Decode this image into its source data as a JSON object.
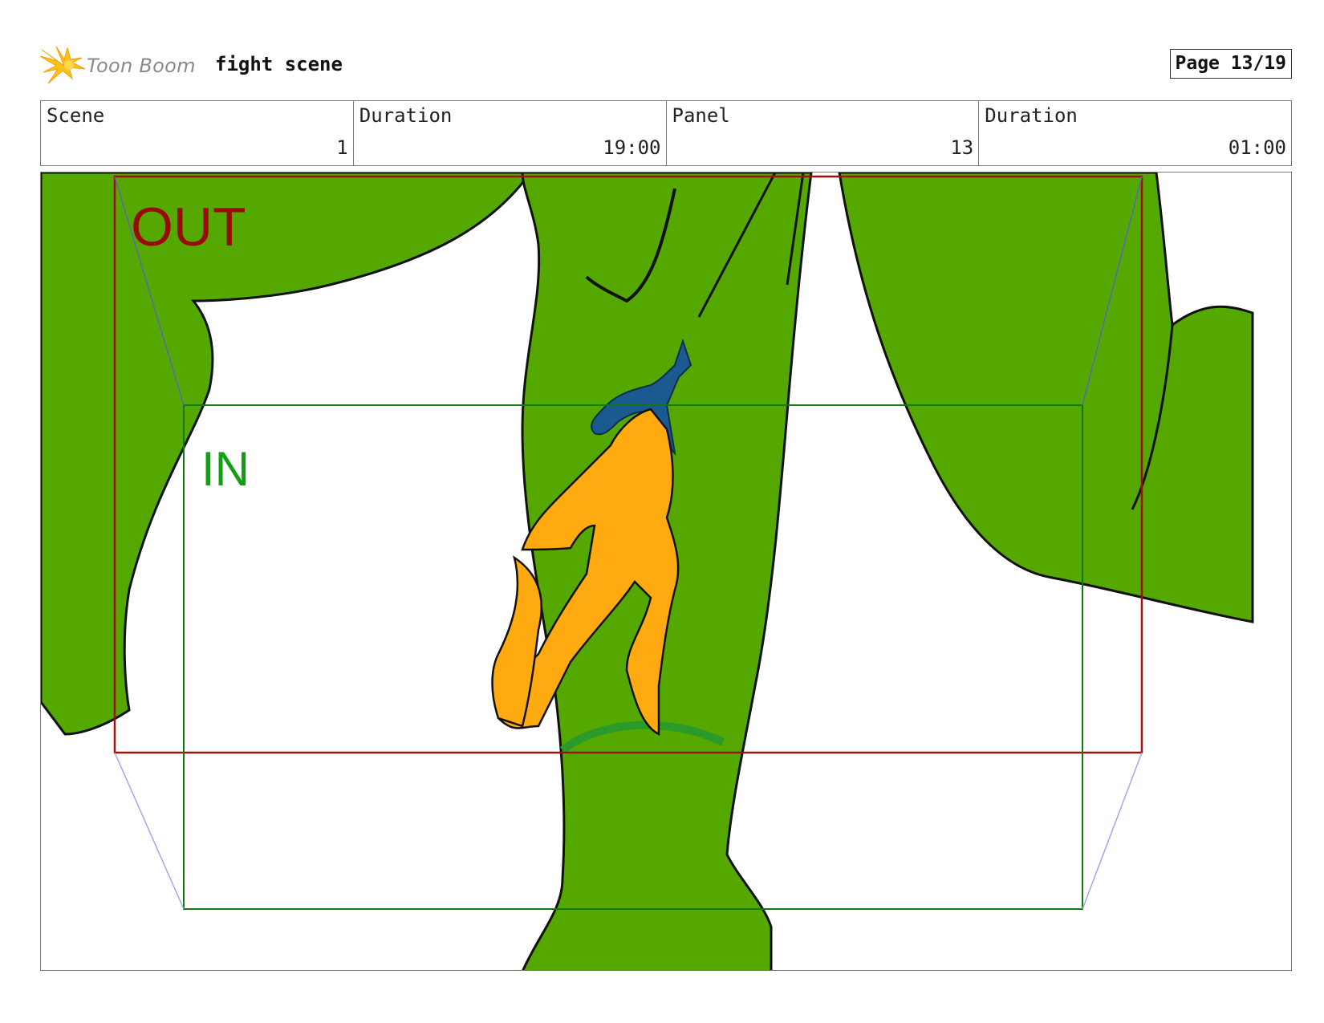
{
  "header": {
    "logo_text": "Toon Boom",
    "project_title": "fight scene",
    "page_label": "Page 13/19"
  },
  "info": [
    {
      "label": "Scene",
      "value": "1"
    },
    {
      "label": "Duration",
      "value": "19:00"
    },
    {
      "label": "Panel",
      "value": "13"
    },
    {
      "label": "Duration",
      "value": "01:00"
    }
  ],
  "panel": {
    "out_label": "OUT",
    "in_label": "IN"
  },
  "colors": {
    "background_green": "#54a800",
    "character_orange": "#ffaa10",
    "character_blue": "#1a5a90",
    "out_frame": "#a01010",
    "in_frame": "#107a10"
  }
}
